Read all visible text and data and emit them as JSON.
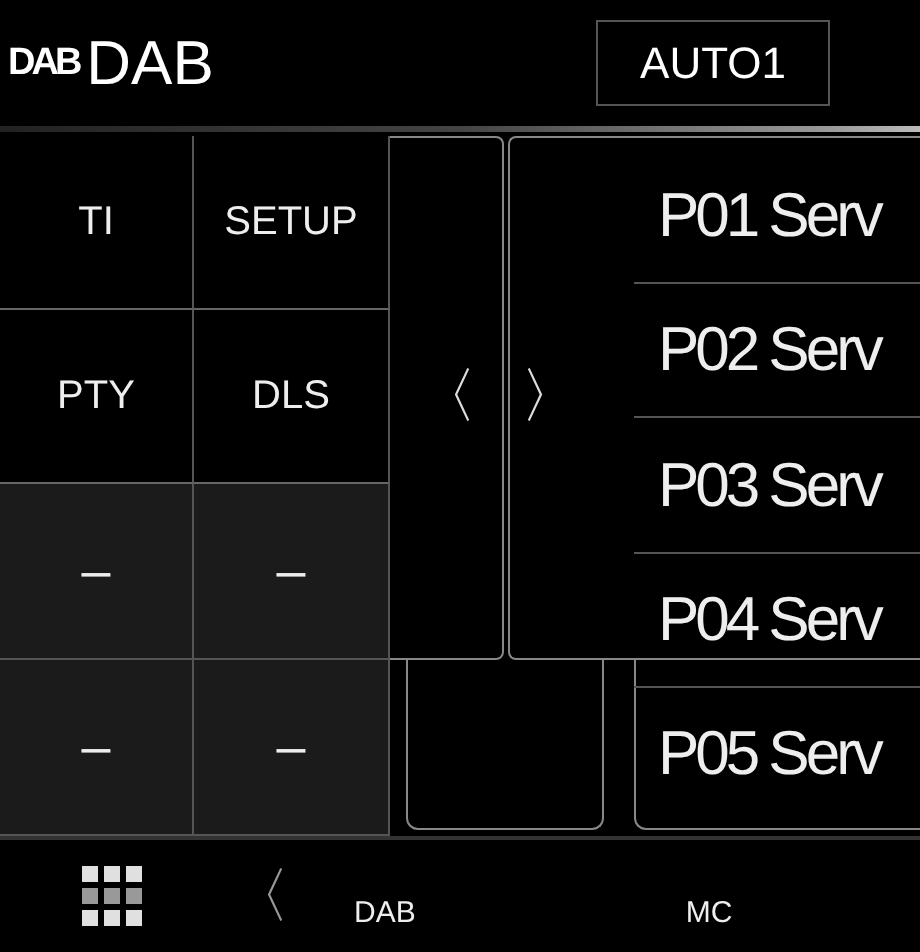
{
  "header": {
    "logo": "DAB",
    "title": "DAB",
    "mode_button": "AUTO1"
  },
  "function_buttons": [
    {
      "label": "TI",
      "kind": "function"
    },
    {
      "label": "SETUP",
      "kind": "function"
    },
    {
      "label": "PTY",
      "kind": "function"
    },
    {
      "label": "DLS",
      "kind": "function"
    },
    {
      "label": "–",
      "kind": "slot"
    },
    {
      "label": "–",
      "kind": "slot"
    },
    {
      "label": "–",
      "kind": "slot"
    },
    {
      "label": "–",
      "kind": "slot"
    }
  ],
  "nav": {
    "prev": "〈",
    "next": "〉"
  },
  "presets": [
    {
      "number": "P01",
      "name": "Serv"
    },
    {
      "number": "P02",
      "name": "Serv"
    },
    {
      "number": "P03",
      "name": "Serv"
    },
    {
      "number": "P04",
      "name": "Serv"
    },
    {
      "number": "P05",
      "name": "Serv"
    }
  ],
  "footer": {
    "back": "〈",
    "items": [
      "DAB",
      "MC"
    ]
  }
}
